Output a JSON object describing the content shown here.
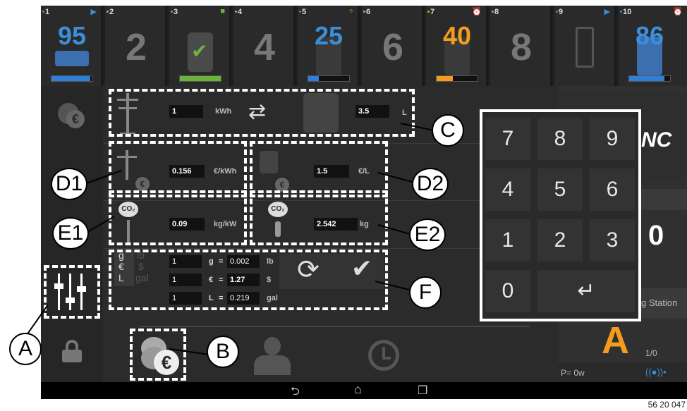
{
  "slots": [
    {
      "num": "1",
      "value": "95",
      "value_color": "#3b8fd9",
      "flag": "play-icon",
      "bar": 0.95,
      "bar_color": "#2f7fd6"
    },
    {
      "num": "2",
      "value": "2",
      "value_color": "#777777"
    },
    {
      "num": "3",
      "value": "",
      "flag": "square-icon",
      "bar": 1.0,
      "bar_color": "#6cb33c"
    },
    {
      "num": "4",
      "value": "4",
      "value_color": "#777777"
    },
    {
      "num": "5",
      "value": "25",
      "value_color": "#3b8fd9",
      "flag": "plus-minus-icon",
      "bar": 0.25,
      "bar_color": "#2f7fd6"
    },
    {
      "num": "6",
      "value": "6",
      "value_color": "#777777"
    },
    {
      "num": "7",
      "value": "40",
      "value_color": "#f39c1f",
      "flag": "alarm-icon",
      "bar": 0.4,
      "bar_color": "#f39c1f"
    },
    {
      "num": "8",
      "value": "8",
      "value_color": "#777777"
    },
    {
      "num": "9",
      "value": "",
      "flag": "play-icon"
    },
    {
      "num": "10",
      "value": "86",
      "value_color": "#3b8fd9",
      "flag": "alarm-icon",
      "bar": 0.86,
      "bar_color": "#2f7fd6"
    }
  ],
  "conversion": {
    "kwh_value": "1",
    "kwh_unit": "kWh",
    "liter_value": "3.5",
    "liter_unit": "L"
  },
  "prices": {
    "elec_price": "0.156",
    "elec_price_unit": "€/kWh",
    "fuel_price": "1.5",
    "fuel_price_unit": "€/L"
  },
  "co2": {
    "elec_co2": "0.09",
    "elec_co2_unit": "kg/kW",
    "fuel_co2": "2.542",
    "fuel_co2_unit": "kg"
  },
  "units_panel": {
    "labels": [
      "g",
      "€",
      "L"
    ],
    "labels_dim": [
      "lb",
      "$",
      "gal"
    ],
    "rows": [
      {
        "input": "1",
        "from": "g",
        "eq": "=",
        "result": "0.002",
        "to": "lb"
      },
      {
        "input": "1",
        "from": "€",
        "eq": "=",
        "result": "1.27",
        "to": "$"
      },
      {
        "input": "1",
        "from": "L",
        "eq": "=",
        "result": "0.219",
        "to": "gal"
      }
    ]
  },
  "keypad": {
    "keys": [
      "7",
      "8",
      "9",
      "4",
      "5",
      "6",
      "1",
      "2",
      "3",
      "0"
    ],
    "enter": "↵"
  },
  "right": {
    "brand_fragment": "NC",
    "big_digit": "0",
    "station": "g Station",
    "big_letter": "A",
    "ratio": "1/0",
    "power": "P= 0w",
    "signal": "((●))•"
  },
  "callouts": {
    "A": "A",
    "B": "B",
    "C": "C",
    "D1": "D1",
    "D2": "D2",
    "E1": "E1",
    "E2": "E2",
    "F": "F"
  },
  "footer_code": "56 20 047",
  "colors": {
    "accent_blue": "#2f7fd6",
    "accent_orange": "#f39c1f",
    "accent_green": "#6cb33c"
  }
}
